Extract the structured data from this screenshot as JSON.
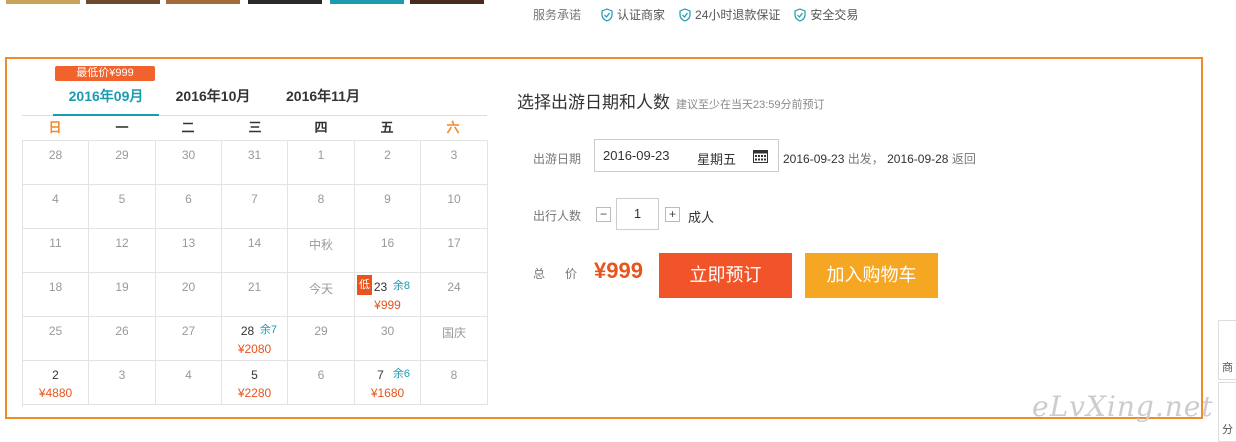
{
  "promise": {
    "label": "服务承诺",
    "items": [
      "认证商家",
      "24小时退款保证",
      "安全交易"
    ]
  },
  "calendar": {
    "low_price_badge": "最低价¥999",
    "tabs": [
      {
        "label": "2016年09月",
        "active": true
      },
      {
        "label": "2016年10月",
        "active": false
      },
      {
        "label": "2016年11月",
        "active": false
      }
    ],
    "weekdays": [
      "日",
      "一",
      "二",
      "三",
      "四",
      "五",
      "六"
    ],
    "weeks": [
      [
        {
          "day": "28"
        },
        {
          "day": "29"
        },
        {
          "day": "30"
        },
        {
          "day": "31"
        },
        {
          "day": "1"
        },
        {
          "day": "2"
        },
        {
          "day": "3"
        }
      ],
      [
        {
          "day": "4"
        },
        {
          "day": "5"
        },
        {
          "day": "6"
        },
        {
          "day": "7"
        },
        {
          "day": "8"
        },
        {
          "day": "9"
        },
        {
          "day": "10"
        }
      ],
      [
        {
          "day": "11"
        },
        {
          "day": "12"
        },
        {
          "day": "13"
        },
        {
          "day": "14"
        },
        {
          "day": "中秋"
        },
        {
          "day": "16"
        },
        {
          "day": "17"
        }
      ],
      [
        {
          "day": "18"
        },
        {
          "day": "19"
        },
        {
          "day": "20"
        },
        {
          "day": "21"
        },
        {
          "day": "今天"
        },
        {
          "day": "23",
          "remaining": "余8",
          "price": "¥999",
          "low": "低"
        },
        {
          "day": "24"
        }
      ],
      [
        {
          "day": "25"
        },
        {
          "day": "26"
        },
        {
          "day": "27"
        },
        {
          "day": "28",
          "remaining": "余7",
          "price": "¥2080"
        },
        {
          "day": "29"
        },
        {
          "day": "30"
        },
        {
          "day": "国庆"
        }
      ],
      [
        {
          "day": "2",
          "price": "¥4880"
        },
        {
          "day": "3"
        },
        {
          "day": "4"
        },
        {
          "day": "5",
          "price": "¥2280"
        },
        {
          "day": "6"
        },
        {
          "day": "7",
          "remaining": "余6",
          "price": "¥1680"
        },
        {
          "day": "8"
        }
      ]
    ]
  },
  "booking": {
    "title": "选择出游日期和人数",
    "hint": "建议至少在当天23:59分前预订",
    "date_label": "出游日期",
    "date_value": "2016-09-23",
    "weekday_value": "星期五",
    "depart_date": "2016-09-23",
    "depart_text": "出发，",
    "return_date": "2016-09-28",
    "return_text": "返回",
    "people_label": "出行人数",
    "minus": "−",
    "quantity": "1",
    "plus": "+",
    "unit": "成人",
    "total_label": "总价",
    "total_price": "¥999",
    "book_button": "立即预订",
    "cart_button": "加入购物车"
  },
  "side_tabs": [
    "商",
    "分"
  ],
  "watermark": "eLvXing.net",
  "colors": {
    "accent": "#1a9bb0",
    "orange": "#f08a2a",
    "price": "#e8541e",
    "book": "#f2542a",
    "cart": "#f5a623"
  }
}
